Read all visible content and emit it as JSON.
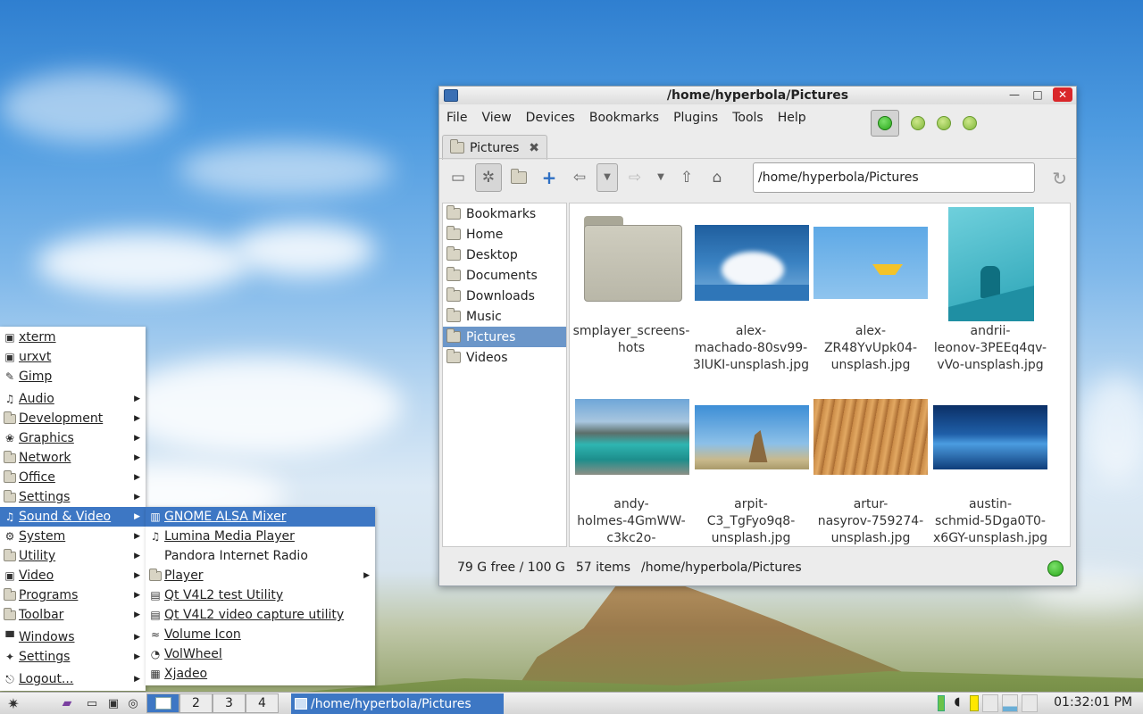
{
  "window": {
    "title": "/home/hyperbola/Pictures",
    "minimize": "—",
    "maximize": "□",
    "close": "✕"
  },
  "menubar": [
    "File",
    "View",
    "Devices",
    "Bookmarks",
    "Plugins",
    "Tools",
    "Help"
  ],
  "tab": {
    "label": "Pictures",
    "close": "✖"
  },
  "toolbar": {
    "path": "/home/hyperbola/Pictures"
  },
  "sidebar": {
    "items": [
      "Bookmarks",
      "Home",
      "Desktop",
      "Documents",
      "Downloads",
      "Music",
      "Pictures",
      "Videos"
    ],
    "selected": "Pictures"
  },
  "files": [
    {
      "name_lines": [
        "smplayer_screens-",
        "hots"
      ]
    },
    {
      "name_lines": [
        "alex-",
        "machado-80sv99-",
        "3lUKI-unsplash.jpg"
      ]
    },
    {
      "name_lines": [
        "alex-",
        "ZR48YvUpk04-",
        "unsplash.jpg"
      ]
    },
    {
      "name_lines": [
        "andrii-",
        "leonov-3PEEq4qv-",
        "vVo-unsplash.jpg"
      ]
    },
    {
      "name_lines": [
        "andy-",
        "holmes-4GmWW-",
        "c3kc2o-"
      ]
    },
    {
      "name_lines": [
        "arpit-",
        "C3_TgFyo9q8-",
        "unsplash.jpg"
      ]
    },
    {
      "name_lines": [
        "artur-",
        "nasyrov-759274-",
        "unsplash.jpg"
      ]
    },
    {
      "name_lines": [
        "austin-",
        "schmid-5Dga0T0-",
        "x6GY-unsplash.jpg"
      ]
    }
  ],
  "status": {
    "free": "79 G free / 100 G",
    "count": "57 items",
    "path": "/home/hyperbola/Pictures"
  },
  "start_menu": {
    "apps": [
      "xterm",
      "urxvt",
      "Gimp"
    ],
    "categories": [
      "Audio",
      "Development",
      "Graphics",
      "Network",
      "Office",
      "Settings",
      "Sound & Video",
      "System",
      "Utility",
      "Video",
      "Programs",
      "Toolbar"
    ],
    "selected": "Sound & Video",
    "bottom": [
      "Windows",
      "Settings",
      "Logout..."
    ]
  },
  "submenu": {
    "items": [
      "GNOME ALSA Mixer",
      "Lumina Media Player",
      "Pandora Internet Radio",
      "Player",
      "Qt V4L2 test Utility",
      "Qt V4L2 video capture utility",
      "Volume Icon",
      "VolWheel",
      "Xjadeo"
    ],
    "selected": "GNOME ALSA Mixer"
  },
  "taskbar": {
    "workspaces": [
      "1",
      "2",
      "3",
      "4"
    ],
    "task_label": "/home/hyperbola/Pictures",
    "clock": "01:32:01 PM"
  }
}
